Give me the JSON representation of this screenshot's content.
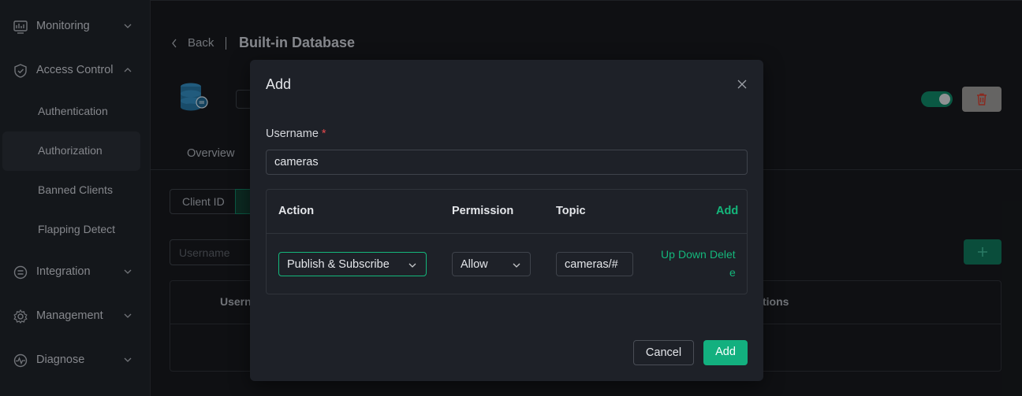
{
  "sidebar": {
    "groups": [
      {
        "label": "Monitoring",
        "icon": "monitor-icon",
        "expanded": false
      },
      {
        "label": "Access Control",
        "icon": "shield-icon",
        "expanded": true
      },
      {
        "label": "Integration",
        "icon": "integration-icon",
        "expanded": false
      },
      {
        "label": "Management",
        "icon": "gear-icon",
        "expanded": false
      },
      {
        "label": "Diagnose",
        "icon": "pulse-icon",
        "expanded": false
      }
    ],
    "access_items": [
      {
        "label": "Authentication"
      },
      {
        "label": "Authorization",
        "active": true
      },
      {
        "label": "Banned Clients"
      },
      {
        "label": "Flapping Detect"
      }
    ]
  },
  "page": {
    "back_label": "Back",
    "title": "Built-in Database",
    "tab_overview": "Overview",
    "segment_client_id": "Client ID",
    "search_placeholder": "Username",
    "table_col_username": "Usern",
    "table_col_actions": "tions"
  },
  "modal": {
    "title": "Add",
    "username_label": "Username",
    "required_mark": "*",
    "username_value": "cameras",
    "rules_header": {
      "action": "Action",
      "permission": "Permission",
      "topic": "Topic",
      "add": "Add"
    },
    "rule": {
      "action": "Publish & Subscribe",
      "permission": "Allow",
      "topic": "cameras/#",
      "up": "Up",
      "down": "Down",
      "delete_part1": "Delet",
      "delete_part2": "e"
    },
    "cancel_label": "Cancel",
    "add_label": "Add"
  },
  "colors": {
    "accent": "#13b07f",
    "background": "#15171b",
    "modal_bg": "#1e2128",
    "required": "#e5484d"
  }
}
